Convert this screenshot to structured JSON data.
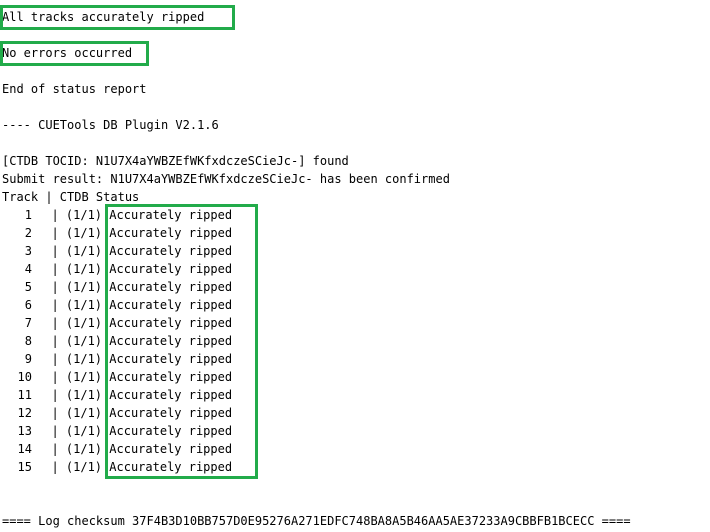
{
  "highlight_color": "#22ab4a",
  "summary": {
    "all_tracks": "All tracks accurately ripped",
    "no_errors": "No errors occurred",
    "end_report": "End of status report"
  },
  "plugin": {
    "header": "---- CUETools DB Plugin V2.1.6",
    "tocid_line": "[CTDB TOCID: N1U7X4aYWBZEfWKfxdczeSCieJc-] found",
    "submit_line": "Submit result: N1U7X4aYWBZEfWKfxdczeSCieJc- has been confirmed",
    "table_header": "Track | CTDB Status"
  },
  "tracks": [
    {
      "track": "1",
      "count": "(1/1)",
      "status": "Accurately ripped"
    },
    {
      "track": "2",
      "count": "(1/1)",
      "status": "Accurately ripped"
    },
    {
      "track": "3",
      "count": "(1/1)",
      "status": "Accurately ripped"
    },
    {
      "track": "4",
      "count": "(1/1)",
      "status": "Accurately ripped"
    },
    {
      "track": "5",
      "count": "(1/1)",
      "status": "Accurately ripped"
    },
    {
      "track": "6",
      "count": "(1/1)",
      "status": "Accurately ripped"
    },
    {
      "track": "7",
      "count": "(1/1)",
      "status": "Accurately ripped"
    },
    {
      "track": "8",
      "count": "(1/1)",
      "status": "Accurately ripped"
    },
    {
      "track": "9",
      "count": "(1/1)",
      "status": "Accurately ripped"
    },
    {
      "track": "10",
      "count": "(1/1)",
      "status": "Accurately ripped"
    },
    {
      "track": "11",
      "count": "(1/1)",
      "status": "Accurately ripped"
    },
    {
      "track": "12",
      "count": "(1/1)",
      "status": "Accurately ripped"
    },
    {
      "track": "13",
      "count": "(1/1)",
      "status": "Accurately ripped"
    },
    {
      "track": "14",
      "count": "(1/1)",
      "status": "Accurately ripped"
    },
    {
      "track": "15",
      "count": "(1/1)",
      "status": "Accurately ripped"
    }
  ],
  "checksum_line": "==== Log checksum 37F4B3D10BB757D0E95276A271EDFC748BA8A5B46AA5AE37233A9CBBFB1BCECC ===="
}
